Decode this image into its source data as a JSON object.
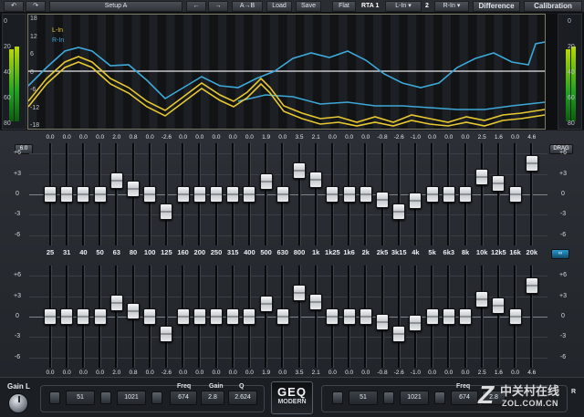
{
  "toolbar": {
    "buttons": [
      "",
      "",
      "Setup A",
      "←",
      "→",
      "A→B",
      "Load",
      "Save",
      "Flat"
    ],
    "rta1_label": "RTA 1",
    "rta1_source": "L-In",
    "rta2_label": "2",
    "rta2_source": "R-In",
    "difference": "Difference",
    "calibration": "Calibration"
  },
  "analyzer": {
    "db_scale": [
      "18",
      "12",
      "6",
      "0",
      "-6",
      "-12",
      "-18"
    ],
    "meter_scale_left": [
      "0",
      "20",
      "40",
      "60",
      "80"
    ],
    "meter_scale_right": [
      "0",
      "20",
      "40",
      "60",
      "80"
    ],
    "legend": [
      {
        "label": "L-In",
        "color": "#e8c830"
      },
      {
        "label": "R-In",
        "color": "#3ea8d8"
      }
    ],
    "meters_left": [
      0.72,
      0.75
    ],
    "meters_right": [
      0.72,
      0.75
    ]
  },
  "scale_labels": [
    "+6",
    "+3",
    "0",
    "-3",
    "-6"
  ],
  "bands": [
    "25",
    "31",
    "40",
    "50",
    "63",
    "80",
    "100",
    "125",
    "160",
    "200",
    "250",
    "315",
    "400",
    "500",
    "630",
    "800",
    "1k",
    "1k25",
    "1k6",
    "2k",
    "2k5",
    "3k15",
    "4k",
    "5k",
    "6k3",
    "8k",
    "10k",
    "12k5",
    "16k",
    "20k"
  ],
  "upper": {
    "values": [
      "0.0",
      "0.0",
      "0.0",
      "0.0",
      "2.0",
      "0.8",
      "0.0",
      "-2.6",
      "0.0",
      "0.0",
      "0.0",
      "0.0",
      "0.0",
      "1.9",
      "0.0",
      "3.5",
      "2.1",
      "0.0",
      "0.0",
      "0.0",
      "-0.8",
      "-2.6",
      "-1.0",
      "0.0",
      "0.0",
      "0.0",
      "2.5",
      "1.6",
      "0.0",
      "4.6"
    ],
    "gains": [
      0,
      0,
      0,
      0,
      2.0,
      0.8,
      0,
      -2.6,
      0,
      0,
      0,
      0,
      0,
      1.9,
      0,
      3.5,
      2.1,
      0,
      0,
      0,
      -0.8,
      -2.6,
      -1.0,
      0,
      0,
      0,
      2.5,
      1.6,
      0,
      4.6
    ],
    "range_button": "6.0",
    "drag_button": "DRAG"
  },
  "lower": {
    "values": [
      "0.0",
      "0.0",
      "0.0",
      "0.0",
      "2.0",
      "0.8",
      "0.0",
      "-2.6",
      "0.0",
      "0.0",
      "0.0",
      "0.0",
      "0.0",
      "1.9",
      "0.0",
      "3.5",
      "2.1",
      "0.0",
      "0.0",
      "0.0",
      "-0.8",
      "-2.6",
      "-1.0",
      "0.0",
      "0.0",
      "0.0",
      "2.5",
      "1.6",
      "0.0",
      "4.6"
    ],
    "gains": [
      0,
      0,
      0,
      0,
      2.0,
      0.8,
      0,
      -2.6,
      0,
      0,
      0,
      0,
      0,
      1.9,
      0,
      3.5,
      2.1,
      0,
      0,
      0,
      -0.8,
      -2.6,
      -1.0,
      0,
      0,
      0,
      2.5,
      1.6,
      0,
      4.6
    ]
  },
  "bottom": {
    "gain_label": "Gain L",
    "left_group": {
      "field1": "51",
      "field2": "1021",
      "freq_label": "Freq",
      "freq_value": "674",
      "gain_label": "Gain",
      "gain_value": "2.8",
      "q_label": "Q",
      "q_value": "2.624"
    },
    "logo_line1": "GEQ",
    "logo_line2": "MODERN",
    "right_group": {
      "field1": "51",
      "field2": "1021",
      "freq_label": "Freq",
      "freq_value": "674",
      "gain_value": "2.8",
      "right_edge_label": "R"
    }
  },
  "watermark": {
    "chinese": "中关村在线",
    "domain": "ZOL.COM.CN"
  }
}
